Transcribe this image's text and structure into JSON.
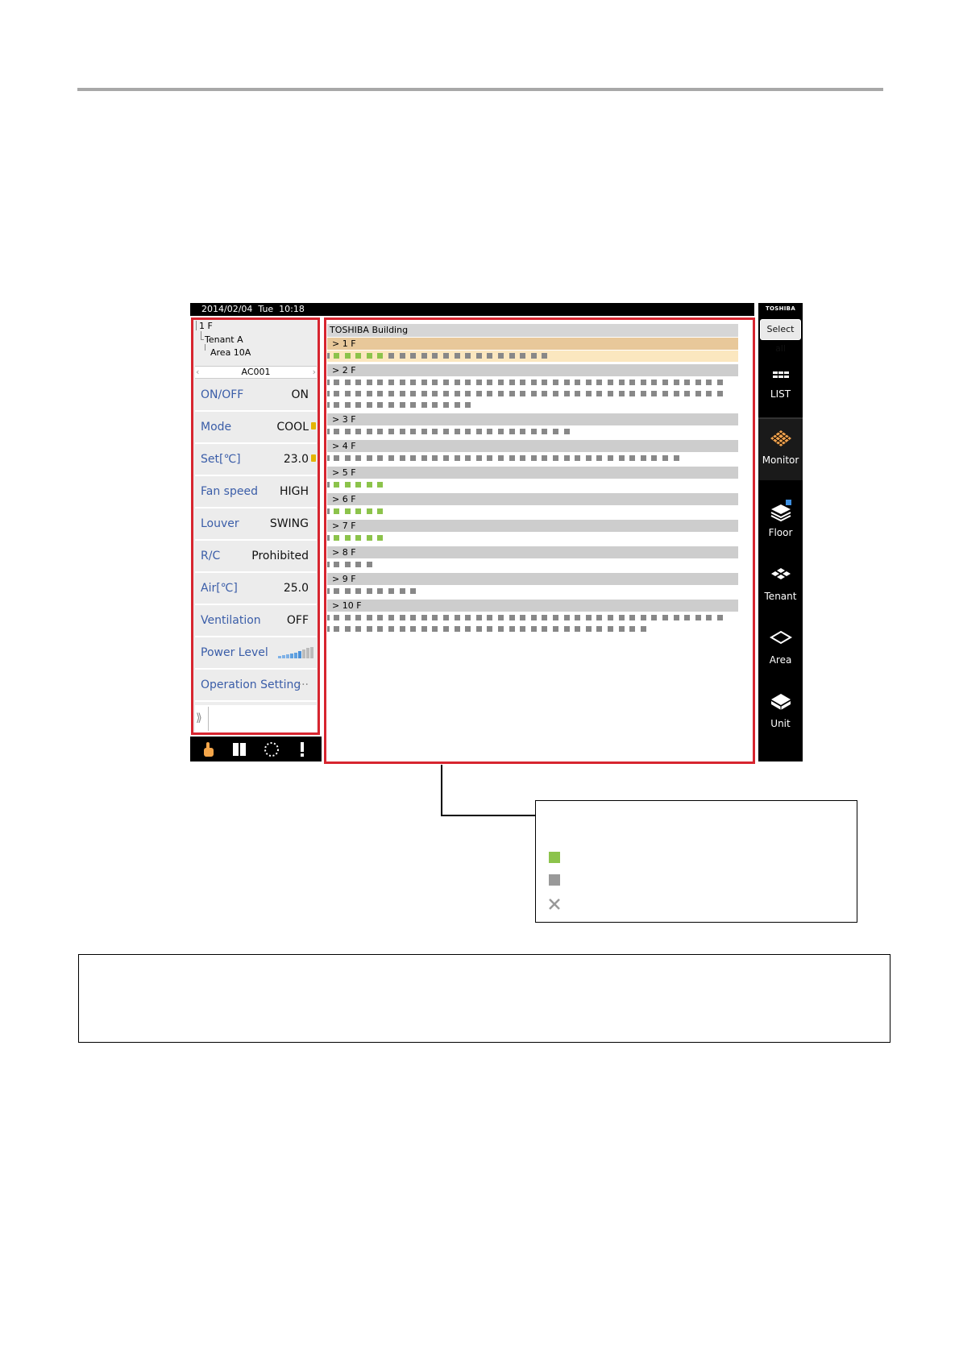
{
  "statusbar": {
    "datetime": "2014/02/04  Tue  10:18",
    "brand": "TOSHIBA"
  },
  "breadcrumb": {
    "floor": "1 F",
    "tenant": "Tenant A",
    "area": "Area 10A",
    "unit": "AC001"
  },
  "settings": [
    {
      "label": "ON/OFF",
      "value": "ON",
      "lock": false
    },
    {
      "label": "Mode",
      "value": "COOL",
      "lock": true
    },
    {
      "label": "Set[℃]",
      "value": "23.0",
      "lock": true
    },
    {
      "label": "Fan speed",
      "value": "HIGH",
      "lock": false
    },
    {
      "label": "Louver",
      "value": "SWING",
      "lock": false
    },
    {
      "label": "R/C",
      "value": "Prohibited",
      "lock": false
    },
    {
      "label": "Air[℃]",
      "value": "25.0",
      "lock": false
    },
    {
      "label": "Ventilation",
      "value": "OFF",
      "lock": false
    },
    {
      "label": "Power Level",
      "value": "",
      "lock": false
    },
    {
      "label": "Operation Setting",
      "value": "···",
      "lock": false
    }
  ],
  "building": {
    "title": "TOSHIBA Building"
  },
  "floors": [
    {
      "label": "> 1 F",
      "selected": true,
      "units": 20,
      "on": 5
    },
    {
      "label": "> 2 F",
      "selected": false,
      "units": 85,
      "on": 0
    },
    {
      "label": "> 3 F",
      "selected": false,
      "units": 22,
      "on": 0
    },
    {
      "label": "> 4 F",
      "selected": false,
      "units": 32,
      "on": 0
    },
    {
      "label": "> 5 F",
      "selected": false,
      "units": 5,
      "on": 5
    },
    {
      "label": "> 6 F",
      "selected": false,
      "units": 5,
      "on": 5
    },
    {
      "label": "> 7 F",
      "selected": false,
      "units": 5,
      "on": 5
    },
    {
      "label": "> 8 F",
      "selected": false,
      "units": 4,
      "on": 0
    },
    {
      "label": "> 9 F",
      "selected": false,
      "units": 8,
      "on": 0
    },
    {
      "label": "> 10 F",
      "selected": false,
      "units": 65,
      "on": 0
    }
  ],
  "nav": {
    "select_all": "Select all",
    "items": [
      {
        "label": "LIST",
        "icon": "list-icon"
      },
      {
        "label": "Monitor",
        "icon": "monitor-icon"
      },
      {
        "label": "Floor",
        "icon": "floor-icon"
      },
      {
        "label": "Tenant",
        "icon": "tenant-icon"
      },
      {
        "label": "Area",
        "icon": "area-icon"
      },
      {
        "label": "Unit",
        "icon": "unit-icon"
      }
    ]
  },
  "callout": {
    "heading": "",
    "legend": [
      {
        "label": ""
      },
      {
        "label": ""
      },
      {
        "label": ""
      }
    ]
  },
  "note": {
    "text": ""
  },
  "colors": {
    "on": "#8cc34b",
    "off": "#888888",
    "highlight": "#d7252f",
    "selected_floor": "#e8c89a"
  }
}
